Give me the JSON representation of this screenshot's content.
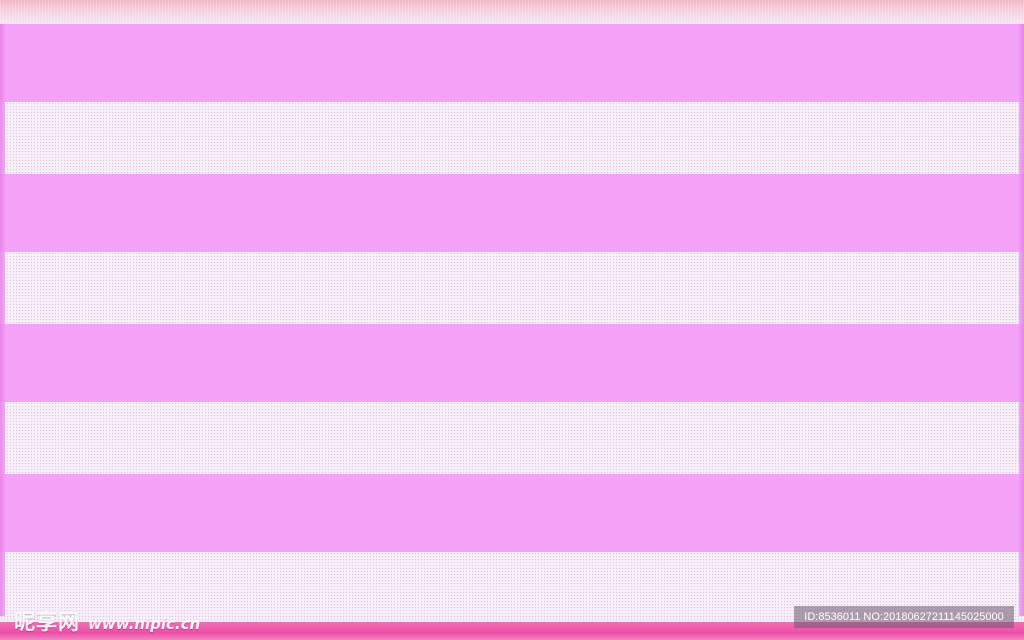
{
  "colors": {
    "pink_stripe": "#f4a2f7",
    "light_stripe": "#f7eff8",
    "top_band": "#f0b3c5",
    "bottom_band": "#ee4fa8"
  },
  "watermark": {
    "logo": "昵享网",
    "url": "www.nipic.cn"
  },
  "image_id_label": "ID:8536011 NO:20180627211145025000"
}
